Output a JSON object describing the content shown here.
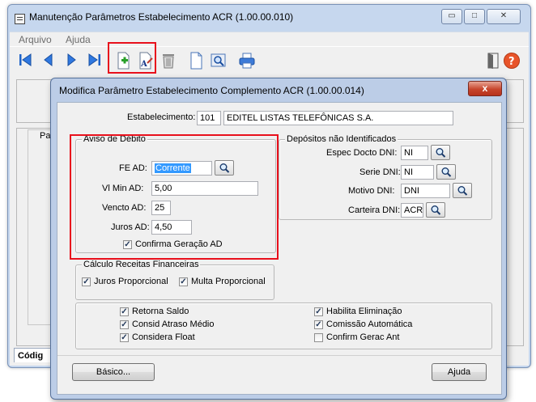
{
  "main_window": {
    "title": "Manutenção Parâmetros Estabelecimento ACR (1.00.00.010)",
    "minimize_glyph": "▭",
    "maximize_glyph": "□",
    "close_glyph": "✕",
    "menu": [
      "Arquivo",
      "Ajuda"
    ],
    "toolbar_icons": [
      "first-record-icon",
      "previous-record-icon",
      "next-record-icon",
      "last-record-icon",
      "add-icon",
      "edit-icon",
      "delete-icon",
      "document-icon",
      "zoom-icon",
      "print-icon",
      "exit-door-icon",
      "help-icon"
    ],
    "panel_label_partial": "Pa",
    "tab_codigo": "Códig"
  },
  "dialog": {
    "title": "Modifica Parâmetro Estabelecimento Complemento ACR (1.00.00.014)",
    "close_glyph": "x",
    "estabelecimento": {
      "label": "Estabelecimento:",
      "code": "101",
      "name": "EDITEL LISTAS TELEFÔNICAS S.A."
    },
    "aviso": {
      "legend": "Aviso de Débito",
      "fe_ad_label": "FE AD:",
      "fe_ad_value": "Corrente",
      "vl_min_label": "Vl Min AD:",
      "vl_min_value": "5,00",
      "vencto_label": "Vencto AD:",
      "vencto_value": "25",
      "juros_label": "Juros AD:",
      "juros_value": "4,50",
      "confirma_label": "Confirma Geração AD",
      "confirma_checked": true
    },
    "depositos": {
      "legend": "Depósitos não Identificados",
      "espec_label": "Espec Docto DNI:",
      "espec_value": "NI",
      "serie_label": "Serie DNI:",
      "serie_value": "NI",
      "motivo_label": "Motivo DNI:",
      "motivo_value": "DNI",
      "carteira_label": "Carteira DNI:",
      "carteira_value": "ACR"
    },
    "calculo": {
      "legend": "Cálculo Receitas Financeiras",
      "juros_label": "Juros Proporcional",
      "juros_checked": true,
      "multa_label": "Multa Proporcional",
      "multa_checked": true
    },
    "options": {
      "retorna_saldo": {
        "label": "Retorna Saldo",
        "checked": true
      },
      "consid_atraso": {
        "label": "Consid Atraso Médio",
        "checked": true
      },
      "considera_float": {
        "label": "Considera Float",
        "checked": true
      },
      "habilita_elim": {
        "label": "Habilita Eliminação",
        "checked": true
      },
      "comissao_auto": {
        "label": "Comissão Automática",
        "checked": true
      },
      "confirm_gerac": {
        "label": "Confirm Gerac Ant",
        "checked": false
      }
    },
    "basico_button": "Básico...",
    "ajuda_button": "Ajuda"
  },
  "colors": {
    "highlight_box": "#e8101c",
    "selection": "#3399ff",
    "titlebar": "#c6d7ee"
  }
}
